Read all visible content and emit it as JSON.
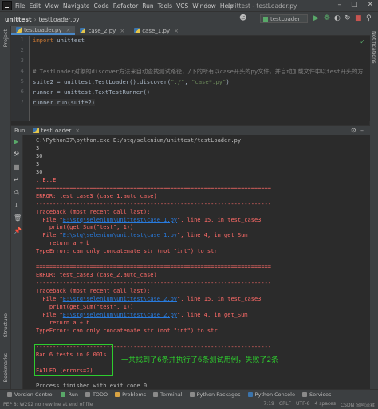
{
  "menubar": {
    "items": [
      "File",
      "Edit",
      "View",
      "Navigate",
      "Code",
      "Refactor",
      "Run",
      "Tools",
      "VCS",
      "Window",
      "Help"
    ],
    "title": "unittest - testLoader.py"
  },
  "navbar": {
    "project": "unittest",
    "file": "testLoader.py",
    "run_config": "testLoader"
  },
  "sidebar_left": {
    "project": "Project",
    "structure": "Structure",
    "bookmarks": "Bookmarks"
  },
  "sidebar_right": {
    "notifications": "Notifications"
  },
  "editor": {
    "tabs": [
      {
        "label": "testLoader.py"
      },
      {
        "label": "case_2.py"
      },
      {
        "label": "case_1.py"
      }
    ],
    "lines": [
      {
        "n": "1",
        "kw": "import",
        "rest": " unittest",
        "type": "import"
      },
      {
        "n": "2",
        "text": "",
        "type": "plain"
      },
      {
        "n": "3",
        "text": "",
        "type": "plain"
      },
      {
        "n": "4",
        "text": "# TestLoader对象的discover方法来自动查找测试路径，/下的所有以case开头的py文件，并自动加载文件中以test开头的方法，并添加到测试套件中",
        "type": "comment"
      },
      {
        "n": "5",
        "pre": "suite2 = unittest.TestLoader().discover(",
        "s1": "\"./\"",
        "mid": ", ",
        "s2": "\"case*.py\"",
        "post": ")",
        "type": "discover"
      },
      {
        "n": "6",
        "text": "runner = unittest.TextTestRunner()",
        "type": "plain"
      },
      {
        "n": "7",
        "text": "runner.run(suite2)",
        "type": "plain"
      }
    ]
  },
  "run": {
    "label": "Run:",
    "tab": "testLoader",
    "console": [
      {
        "cls": "w",
        "text": "C:\\Python37\\python.exe E:/stq/selenium/unittest/testLoader.py"
      },
      {
        "cls": "w",
        "text": "3"
      },
      {
        "cls": "w",
        "text": "30"
      },
      {
        "cls": "w",
        "text": "3"
      },
      {
        "cls": "w",
        "text": "30"
      },
      {
        "cls": "r",
        "text": "..E..E"
      },
      {
        "cls": "r",
        "text": "======================================================================"
      },
      {
        "cls": "r",
        "text": "ERROR: test_case3 (case_1.auto_case)"
      },
      {
        "cls": "r",
        "text": "----------------------------------------------------------------------"
      },
      {
        "cls": "r",
        "text": "Traceback (most recent call last):"
      },
      {
        "cls": "r",
        "pre": "  File \"",
        "link": "E:\\stq\\selenium\\unittest\\case_1.py",
        "post": "\", line 15, in test_case3"
      },
      {
        "cls": "r",
        "text": "    print(get_Sum(\"test\", 1))"
      },
      {
        "cls": "r",
        "pre": "  File \"",
        "link": "E:\\stq\\selenium\\unittest\\case_1.py",
        "post": "\", line 4, in get_Sum"
      },
      {
        "cls": "r",
        "text": "    return a + b"
      },
      {
        "cls": "r",
        "text": "TypeError: can only concatenate str (not \"int\") to str"
      },
      {
        "cls": "r",
        "text": ""
      },
      {
        "cls": "r",
        "text": "======================================================================"
      },
      {
        "cls": "r",
        "text": "ERROR: test_case3 (case_2.auto_case)"
      },
      {
        "cls": "r",
        "text": "----------------------------------------------------------------------"
      },
      {
        "cls": "r",
        "text": "Traceback (most recent call last):"
      },
      {
        "cls": "r",
        "pre": "  File \"",
        "link": "E:\\stq\\selenium\\unittest\\case_2.py",
        "post": "\", line 15, in test_case3"
      },
      {
        "cls": "r",
        "text": "    print(get_Sum(\"test\", 1))"
      },
      {
        "cls": "r",
        "pre": "  File \"",
        "link": "E:\\stq\\selenium\\unittest\\case_2.py",
        "post": "\", line 4, in get_Sum"
      },
      {
        "cls": "r",
        "text": "    return a + b"
      },
      {
        "cls": "r",
        "text": "TypeError: can only concatenate str (not \"int\") to str"
      },
      {
        "cls": "r",
        "text": ""
      },
      {
        "cls": "r",
        "text": "----------------------------------------------------------------------"
      },
      {
        "cls": "r",
        "text": "Ran 6 tests in 0.001s"
      },
      {
        "cls": "r",
        "text": ""
      },
      {
        "cls": "r",
        "text": "FAILED (errors=2)"
      },
      {
        "cls": "w",
        "text": ""
      },
      {
        "cls": "w",
        "text": "Process finished with exit code 0"
      }
    ],
    "annotation": "一共找到了6条并执行了6条测试用例，失败了2条"
  },
  "bottom_tools": [
    {
      "label": "Version Control",
      "color": "#8a8a8a"
    },
    {
      "label": "Run",
      "color": "#59a869"
    },
    {
      "label": "TODO",
      "color": "#8a8a8a"
    },
    {
      "label": "Problems",
      "color": "#d9a343"
    },
    {
      "label": "Terminal",
      "color": "#8a8a8a"
    },
    {
      "label": "Python Packages",
      "color": "#8a8a8a"
    },
    {
      "label": "Python Console",
      "color": "#3b74ac"
    },
    {
      "label": "Services",
      "color": "#8a8a8a"
    }
  ],
  "status": {
    "message": "PEP 8: W292 no newline at end of file",
    "position": "7:19",
    "crlf": "CRLF",
    "encoding": "UTF-8",
    "indent": "4 spaces",
    "watermark": "CSDN @阿泽君"
  }
}
